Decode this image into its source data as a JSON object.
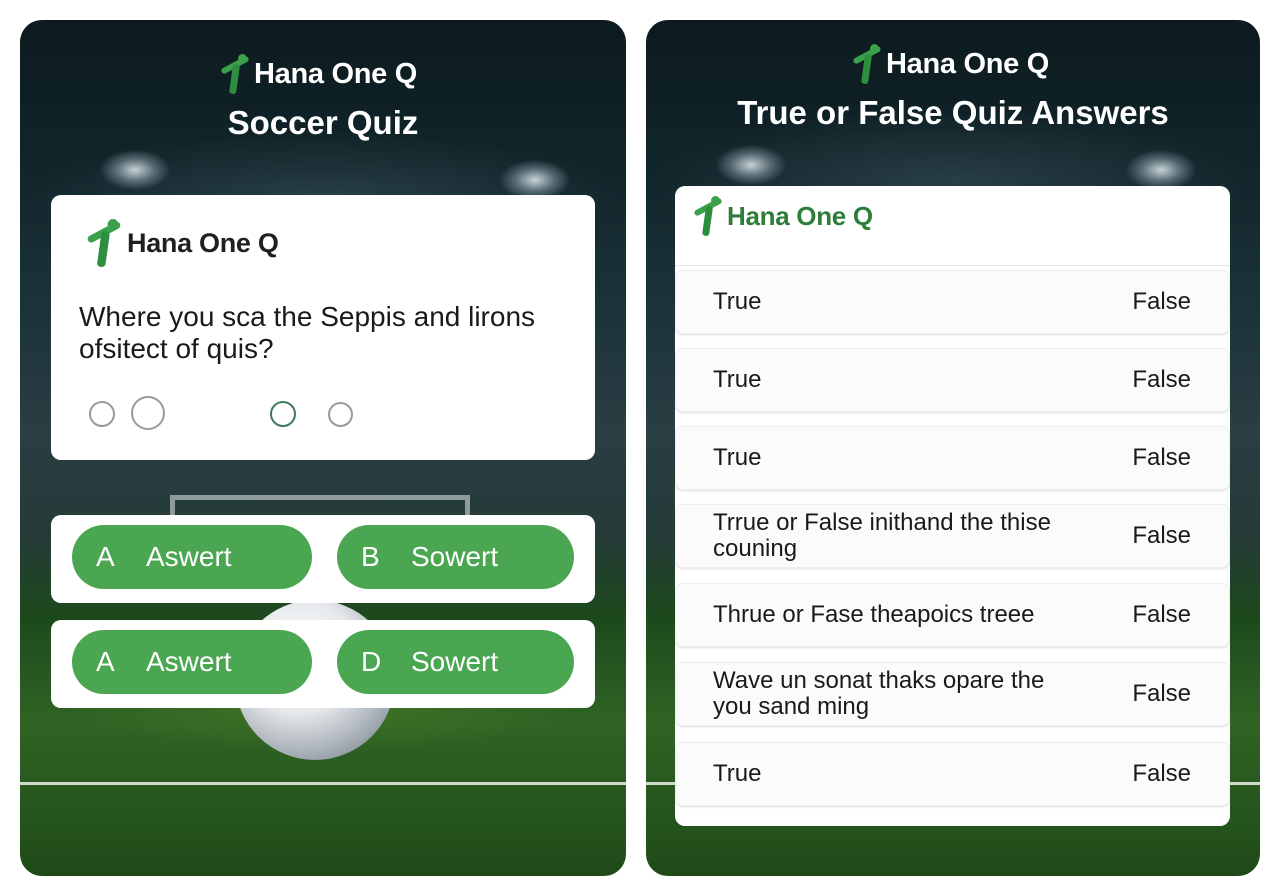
{
  "colors": {
    "brand_green": "#3aa04a",
    "answer_green": "#4aa651",
    "card_white": "#ffffff"
  },
  "left": {
    "logo_text": "Hana One Q",
    "title": "Soccer Quiz",
    "card": {
      "logo_text": "Hana One Q",
      "question": "Where you sca the Seppis and lirons ofsitect of quis?",
      "radio_options": [
        "",
        "",
        "",
        ""
      ]
    },
    "answers": [
      {
        "letter": "A",
        "label": "Aswert"
      },
      {
        "letter": "B",
        "label": "Sowert"
      },
      {
        "letter": "A",
        "label": "Aswert"
      },
      {
        "letter": "D",
        "label": "Sowert"
      }
    ]
  },
  "right": {
    "logo_text": "Hana One Q",
    "title": "True or False Quiz Answers",
    "list_logo_text": "Hana One Q",
    "rows": [
      {
        "left": "True",
        "right": "False"
      },
      {
        "left": "True",
        "right": "False"
      },
      {
        "left": "True",
        "right": "False"
      },
      {
        "left": "Trrue or False inithand the thise couning",
        "right": "False"
      },
      {
        "left": "Thrue or Fase theapoics treee",
        "right": "False"
      },
      {
        "left": "Wave un sonat thaks opare the you sand ming",
        "right": "False"
      },
      {
        "left": "True",
        "right": "False"
      }
    ]
  }
}
